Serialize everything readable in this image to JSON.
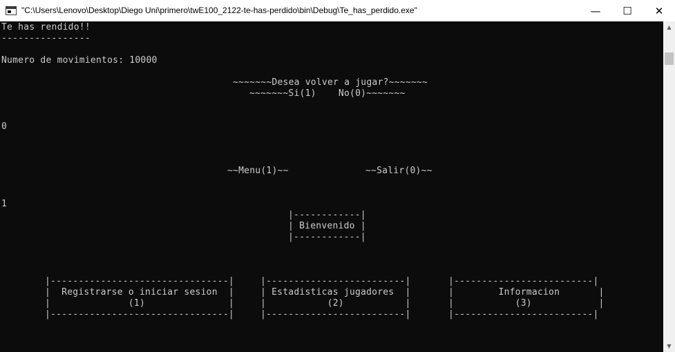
{
  "window": {
    "title": "\"C:\\Users\\Lenovo\\Desktop\\Diego Uni\\primero\\twE100_2122-te-has-perdido\\bin\\Debug\\Te_has_perdido.exe\"",
    "minimize_glyph": "—",
    "maximize_glyph": "☐",
    "close_glyph": "✕",
    "icon": "console-app-icon"
  },
  "console": {
    "background": "#0c0c0c",
    "foreground": "#cccccc",
    "lines": {
      "surrender": "Te has rendido!!",
      "underline": "----------------",
      "moves": "Numero de movimientos: 10000",
      "play_again": "~~~~~~~Desea volver a jugar?~~~~~~~",
      "play_again_options": "~~~~~~~Si(1)    No(0)~~~~~~~",
      "input_1": "0",
      "menu_option": "~~Menu(1)~~",
      "exit_option": "~~Salir(0)~~",
      "input_2": "1",
      "welcome_top": "|------------|",
      "welcome_mid": "| Bienvenido |",
      "welcome_bottom": "|------------|",
      "box1_top": "|--------------------------------|",
      "box1_label": "|  Registrarse o iniciar sesion  |",
      "box1_num": "|              (1)               |",
      "box1_bottom": "|--------------------------------|",
      "box2_top": "|-------------------------|",
      "box2_label": "| Estadisticas jugadores  |",
      "box2_num": "|           (2)           |",
      "box2_bottom": "|-------------------------|",
      "box3_top": "|-------------------------|",
      "box3_label": "|        Informacion       |",
      "box3_num": "|           (3)            |",
      "box3_bottom": "|-------------------------|"
    }
  },
  "scrollbar": {
    "up_glyph": "▲",
    "down_glyph": "▼"
  }
}
